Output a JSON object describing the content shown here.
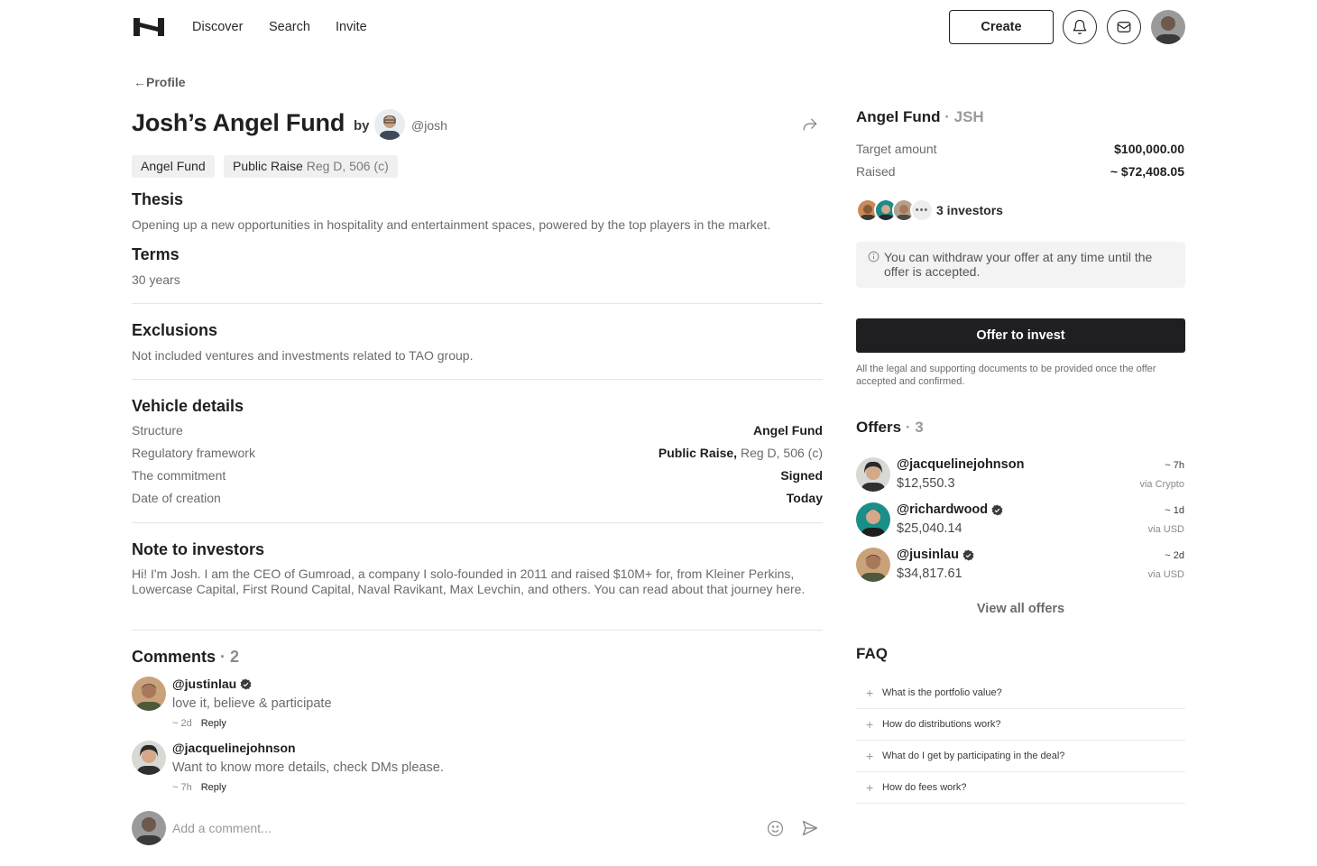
{
  "nav": {
    "links": [
      "Discover",
      "Search",
      "Invite"
    ],
    "create_label": "Create"
  },
  "back": {
    "label": "Profile"
  },
  "fund": {
    "title": "Josh’s Angel Fund",
    "by": "by",
    "owner_handle": "@josh",
    "chips": {
      "type": "Angel Fund",
      "raise_main": "Public Raise",
      "raise_detail": "Reg D, 506 (c)"
    }
  },
  "thesis": {
    "title": "Thesis",
    "text": "Opening up a new opportunities in hospitality and entertainment spaces, powered by the top players in the market."
  },
  "terms": {
    "title": "Terms",
    "text": "30 years"
  },
  "exclusions": {
    "title": "Exclusions",
    "text": "Not included ventures and investments related to TAO group."
  },
  "vehicle": {
    "title": "Vehicle details",
    "rows": [
      {
        "label": "Structure",
        "value": "Angel Fund",
        "detail": ""
      },
      {
        "label": "Regulatory framework",
        "value": "Public Raise,",
        "detail": " Reg D, 506 (c)"
      },
      {
        "label": "The commitment",
        "value": "Signed",
        "detail": ""
      },
      {
        "label": "Date of creation",
        "value": "Today",
        "detail": ""
      }
    ]
  },
  "note": {
    "title": "Note to investors",
    "text": "Hi! I'm Josh. I am the CEO of Gumroad, a company I solo-founded in 2011 and raised $10M+ for, from Kleiner Perkins, Lowercase Capital, First Round Capital, Naval Ravikant, Max Levchin, and others. You can read about that journey here."
  },
  "comments": {
    "title": "Comments",
    "count": "2",
    "items": [
      {
        "user": "@justinlau",
        "text": "love it, believe & participate",
        "time": "~ 2d",
        "reply": "Reply"
      },
      {
        "user": "@jacquelinejohnson",
        "text": "Want to know more details, check DMs please.",
        "time": "~ 7h",
        "reply": "Reply"
      }
    ],
    "placeholder": "Add a comment..."
  },
  "summary": {
    "title": "Angel Fund",
    "ticker": "JSH",
    "target_label": "Target amount",
    "target_value": "$100,000.00",
    "raised_label": "Raised",
    "raised_value": "~ $72,408.05",
    "investors_label": "3 investors",
    "notice": "You can withdraw your offer at any time until the offer is accepted.",
    "offer_button": "Offer to invest",
    "legal": "All the legal and supporting documents to be provided once the offer accepted and confirmed."
  },
  "offers": {
    "title": "Offers",
    "count": "3",
    "items": [
      {
        "user": "@jacquelinejohnson",
        "amount": "$12,550.3",
        "time": "~ 7h",
        "via": "via Crypto"
      },
      {
        "user": "@richardwood",
        "amount": "$25,040.14",
        "time": "~ 1d",
        "via": "via USD"
      },
      {
        "user": "@jusinlau",
        "amount": "$34,817.61",
        "time": "~ 2d",
        "via": "via USD"
      }
    ],
    "view_all": "View all offers"
  },
  "faq": {
    "title": "FAQ",
    "items": [
      "What is the portfolio value?",
      "How do distributions work?",
      "What do I get by participating in the deal?",
      "How do fees work?"
    ]
  },
  "colors": {
    "primary": "#1f1f22",
    "muted_text": "#6b6b6b",
    "chip_bg": "#f0f0f0",
    "notice_bg": "#f3f3f3"
  }
}
